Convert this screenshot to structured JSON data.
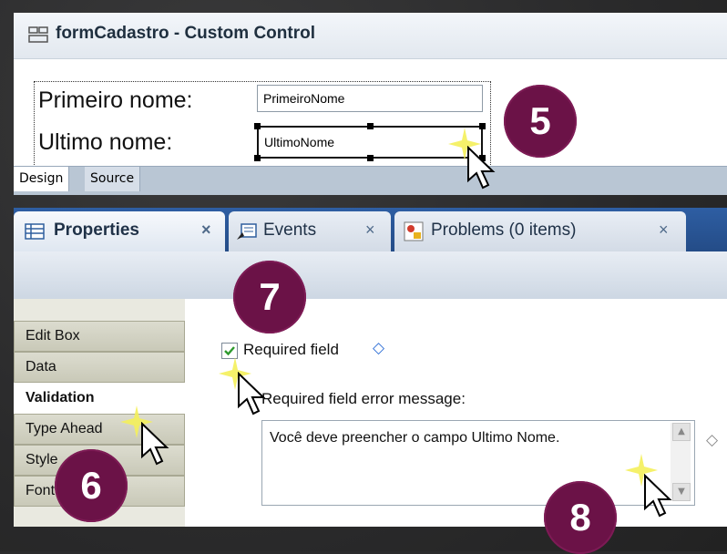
{
  "designer": {
    "title": "formCadastro - Custom Control",
    "form": {
      "first_name_label": "Primeiro nome:",
      "first_name_value": "PrimeiroNome",
      "last_name_label": "Ultimo nome:",
      "last_name_value": "UltimoNome"
    },
    "tabs": [
      "Design",
      "Source"
    ]
  },
  "properties": {
    "tabs": [
      {
        "label": "Properties",
        "icon": "properties-icon",
        "close": "×"
      },
      {
        "label": "Events",
        "icon": "events-icon",
        "close": "×"
      },
      {
        "label": "Problems (0 items)",
        "icon": "problems-icon",
        "close": "×"
      }
    ],
    "side_nav": [
      {
        "label": "Edit Box"
      },
      {
        "label": "Data"
      },
      {
        "label": "Validation"
      },
      {
        "label": "Type Ahead"
      },
      {
        "label": "Style"
      },
      {
        "label": "Font"
      }
    ],
    "required_label": "Required field",
    "required_checked": true,
    "diamond": "◇",
    "error_message_label": "Required field error message:",
    "error_message_value": "Você deve preencher o campo Ultimo Nome."
  },
  "badges": {
    "b5": "5",
    "b6": "6",
    "b7": "7",
    "b8": "8"
  },
  "colors": {
    "badge": "#6b1247",
    "tabbar": "#2e5ea3"
  }
}
